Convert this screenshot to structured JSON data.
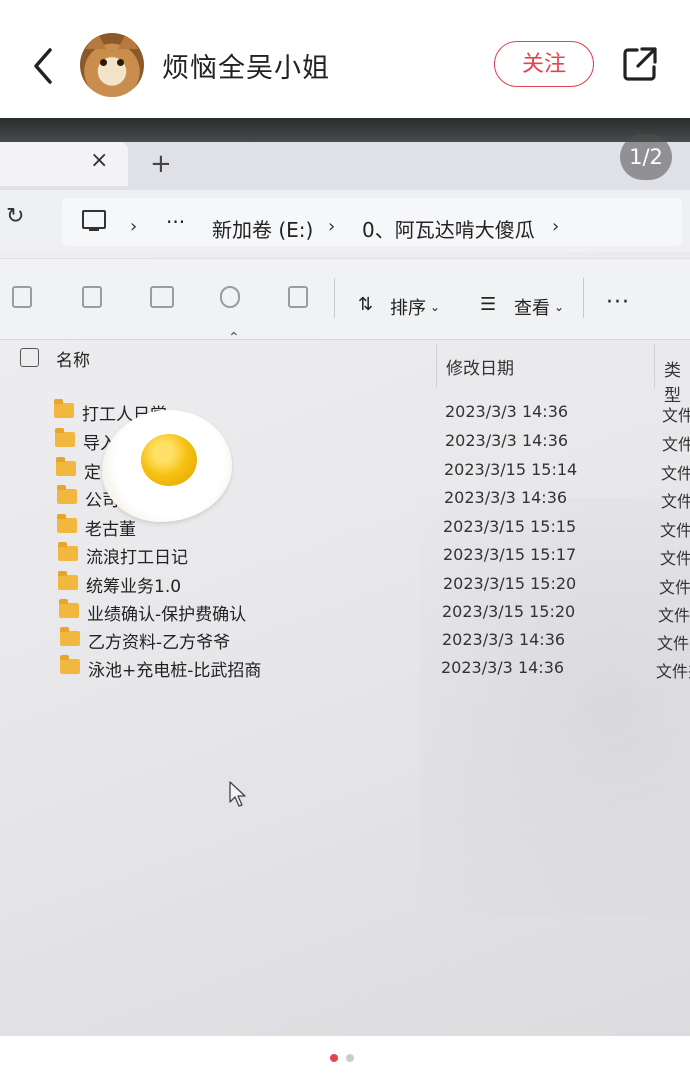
{
  "topbar": {
    "username": "烦恼全吴小姐",
    "follow_label": "关注",
    "back_icon": "chevron-left-icon",
    "share_icon": "share-external-icon"
  },
  "photo": {
    "pager": "1/2",
    "explorer": {
      "tab_close": "×",
      "tab_new": "+",
      "breadcrumb": [
        "›",
        "···",
        "新加卷 (E:)",
        "›",
        "0、阿瓦达啃大傻瓜",
        "›"
      ],
      "toolbar": {
        "sort_label": "排序",
        "view_label": "查看",
        "more_label": "···",
        "icons": [
          "copy-icon",
          "paste-icon",
          "rename-icon",
          "share-icon",
          "delete-icon",
          "sort-icon",
          "view-icon"
        ]
      },
      "columns": {
        "name": "名称",
        "date": "修改日期",
        "type": "类型"
      },
      "files": [
        {
          "name": "打工人日常",
          "date": "2023/3/3 14:36",
          "type": "文件"
        },
        {
          "name": "导入",
          "date": "2023/3/3 14:36",
          "type": "文件"
        },
        {
          "name": "定位PDF",
          "date": "2023/3/15 15:14",
          "type": "文件"
        },
        {
          "name": "公司",
          "date": "2023/3/3 14:36",
          "type": "文件"
        },
        {
          "name": "老古董",
          "date": "2023/3/15 15:15",
          "type": "文件"
        },
        {
          "name": "流浪打工日记",
          "date": "2023/3/15 15:17",
          "type": "文件"
        },
        {
          "name": "统筹业务1.0",
          "date": "2023/3/15 15:20",
          "type": "文件"
        },
        {
          "name": "业绩确认-保护费确认",
          "date": "2023/3/15 15:20",
          "type": "文件夹"
        },
        {
          "name": "乙方资料-乙方爷爷",
          "date": "2023/3/3 14:36",
          "type": "文件夹"
        },
        {
          "name": "泳池+充电桩-比武招商",
          "date": "2023/3/3 14:36",
          "type": "文件夹"
        }
      ]
    },
    "sticker": "fried-egg-sticker"
  },
  "carousel": {
    "active_color": "#e8424f",
    "inactive_color": "#cccccc"
  }
}
